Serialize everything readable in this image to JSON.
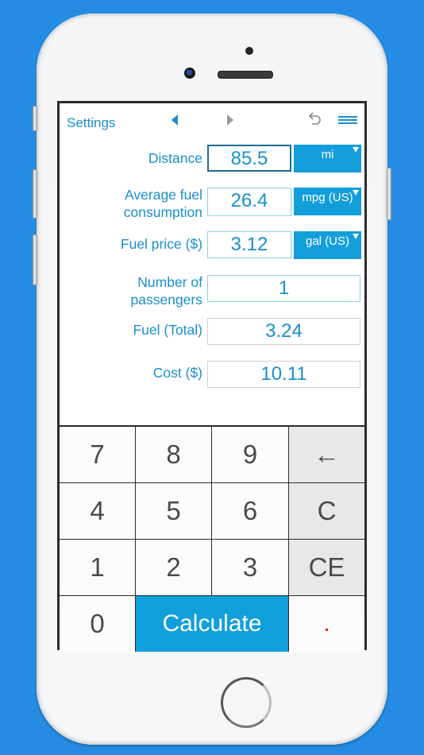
{
  "header": {
    "settings_label": "Settings",
    "prev_icon": "triangle-left-icon",
    "next_icon": "triangle-right-icon",
    "undo_icon": "undo-arrow-icon",
    "menu_icon": "hamburger-menu-icon"
  },
  "form": {
    "distance": {
      "label": "Distance",
      "value": "85.5",
      "unit": "mi"
    },
    "consumption": {
      "label_line1": "Average fuel",
      "label_line2": "consumption",
      "value": "26.4",
      "unit": "mpg (US)"
    },
    "price": {
      "label": "Fuel price ($)",
      "value": "3.12",
      "unit": "gal (US)"
    },
    "passengers": {
      "label_line1": "Number of",
      "label_line2": "passengers",
      "value": "1"
    },
    "fuel_total": {
      "label": "Fuel (Total)",
      "value": "3.24"
    },
    "cost": {
      "label": "Cost ($)",
      "value": "10.11"
    }
  },
  "keypad": {
    "keys": [
      "7",
      "8",
      "9",
      "←",
      "4",
      "5",
      "6",
      "C",
      "1",
      "2",
      "3",
      "CE",
      "0",
      "Calculate",
      "."
    ]
  },
  "colors": {
    "background": "#268ce3",
    "accent": "#139edb",
    "text_accent": "#1a8fc9",
    "function_key": "#e8e8e8",
    "dot_key": "#e02020"
  }
}
